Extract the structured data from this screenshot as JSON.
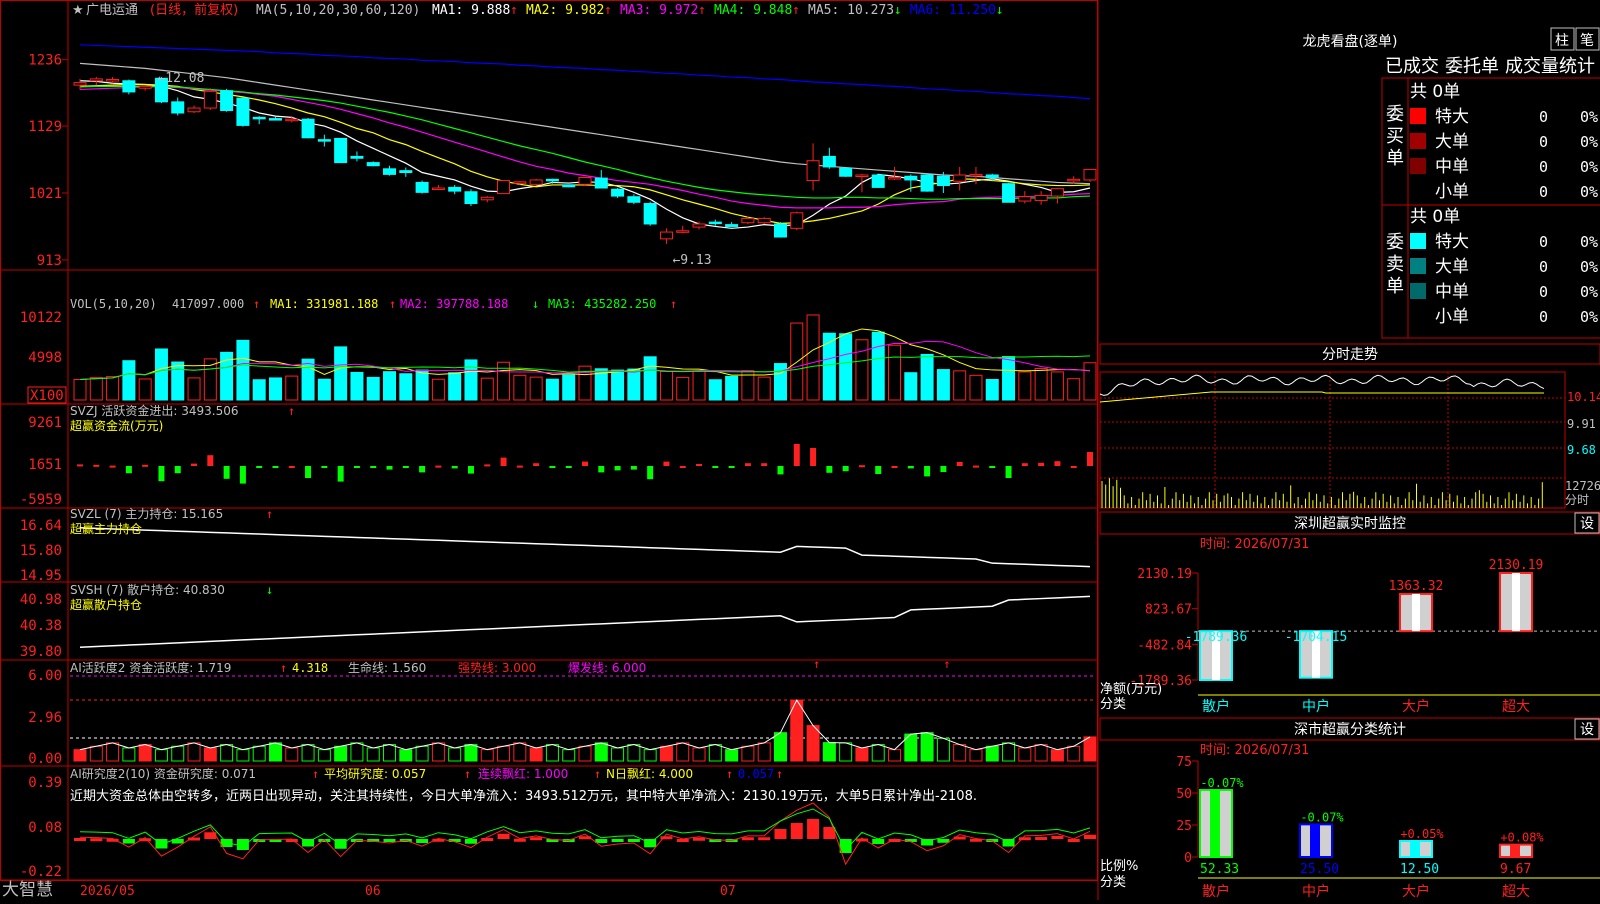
{
  "colors": {
    "up": "#ff2020",
    "down": "#00ffff",
    "frame": "#c00000",
    "ma1": "#ffffff",
    "ma2": "#ffff00",
    "ma3": "#ff00ff",
    "ma4": "#00ff00",
    "ma5": "#c0c0c0",
    "ma6": "#0000ff",
    "text": "#c0c0c0",
    "green": "#00ff00",
    "yellow": "#ffff00"
  },
  "main": {
    "title_star": "★",
    "title_name": "广电运通",
    "title_period": "(日线，前复权)",
    "ma_label": "MA(5,10,20,30,60,120)",
    "ma_items": [
      {
        "label": "MA1:",
        "value": "9.888",
        "arrow": "↑"
      },
      {
        "label": "MA2:",
        "value": "9.982",
        "arrow": "↑"
      },
      {
        "label": "MA3:",
        "value": "9.972",
        "arrow": "↑"
      },
      {
        "label": "MA4:",
        "value": "9.848",
        "arrow": "↑"
      },
      {
        "label": "MA5:",
        "value": "10.273",
        "arrow": "↓"
      },
      {
        "label": "MA6:",
        "value": "11.250",
        "arrow": "↓"
      }
    ],
    "y_ticks": [
      "1236",
      "1129",
      "1021",
      "913"
    ],
    "high_note": "←12.08",
    "low_note": "←9.13"
  },
  "chart_data": {
    "type": "candlestick",
    "dates_axis": [
      "2026/05",
      "06",
      "07"
    ],
    "ohlc": [
      [
        11.95,
        12.05,
        11.88,
        11.99
      ],
      [
        12.02,
        12.08,
        11.95,
        12.05
      ],
      [
        12.03,
        12.08,
        11.98,
        12.04
      ],
      [
        12.02,
        12.04,
        11.8,
        11.84
      ],
      [
        11.9,
        11.95,
        11.86,
        11.93
      ],
      [
        12.06,
        12.08,
        11.66,
        11.68
      ],
      [
        11.68,
        11.75,
        11.46,
        11.5
      ],
      [
        11.52,
        11.62,
        11.5,
        11.58
      ],
      [
        11.58,
        11.9,
        11.55,
        11.85
      ],
      [
        11.86,
        11.89,
        11.52,
        11.54
      ],
      [
        11.74,
        11.76,
        11.28,
        11.3
      ],
      [
        11.43,
        11.45,
        11.32,
        11.41
      ],
      [
        11.41,
        11.44,
        11.38,
        11.4
      ],
      [
        11.4,
        11.45,
        11.35,
        11.4
      ],
      [
        11.4,
        11.42,
        11.09,
        11.1
      ],
      [
        11.07,
        11.15,
        10.96,
        11.06
      ],
      [
        11.09,
        11.09,
        10.7,
        10.7
      ],
      [
        10.8,
        10.88,
        10.72,
        10.77
      ],
      [
        10.7,
        10.72,
        10.64,
        10.65
      ],
      [
        10.6,
        10.65,
        10.49,
        10.51
      ],
      [
        10.57,
        10.62,
        10.47,
        10.54
      ],
      [
        10.38,
        10.41,
        10.2,
        10.22
      ],
      [
        10.28,
        10.34,
        10.26,
        10.29
      ],
      [
        10.3,
        10.34,
        10.19,
        10.24
      ],
      [
        10.23,
        10.27,
        10.0,
        10.04
      ],
      [
        10.1,
        10.16,
        10.06,
        10.14
      ],
      [
        10.2,
        10.41,
        10.2,
        10.41
      ],
      [
        10.38,
        10.4,
        10.34,
        10.39
      ],
      [
        10.35,
        10.44,
        10.34,
        10.42
      ],
      [
        10.43,
        10.44,
        10.36,
        10.42
      ],
      [
        10.34,
        10.34,
        10.3,
        10.31
      ],
      [
        10.35,
        10.47,
        10.32,
        10.46
      ],
      [
        10.45,
        10.58,
        10.29,
        10.29
      ],
      [
        10.27,
        10.29,
        10.13,
        10.16
      ],
      [
        10.15,
        10.19,
        10.03,
        10.06
      ],
      [
        10.04,
        10.07,
        9.68,
        9.71
      ],
      [
        9.47,
        9.64,
        9.39,
        9.58
      ],
      [
        9.6,
        9.68,
        9.56,
        9.6
      ],
      [
        9.66,
        9.75,
        9.62,
        9.71
      ],
      [
        9.74,
        9.78,
        9.68,
        9.72
      ],
      [
        9.7,
        9.74,
        9.66,
        9.67
      ],
      [
        9.73,
        9.83,
        9.71,
        9.8
      ],
      [
        9.73,
        9.82,
        9.71,
        9.8
      ],
      [
        9.71,
        9.74,
        9.49,
        9.5
      ],
      [
        9.64,
        9.91,
        9.61,
        9.89
      ],
      [
        10.41,
        11.01,
        10.25,
        10.73
      ],
      [
        10.8,
        10.94,
        10.6,
        10.63
      ],
      [
        10.61,
        10.62,
        10.47,
        10.48
      ],
      [
        10.48,
        10.52,
        10.22,
        10.5
      ],
      [
        10.5,
        10.52,
        10.29,
        10.3
      ],
      [
        10.46,
        10.63,
        10.42,
        10.46
      ],
      [
        10.48,
        10.51,
        10.23,
        10.42
      ],
      [
        10.5,
        10.51,
        10.23,
        10.24
      ],
      [
        10.48,
        10.55,
        10.21,
        10.33
      ],
      [
        10.4,
        10.63,
        10.25,
        10.5
      ],
      [
        10.5,
        10.63,
        10.35,
        10.51
      ],
      [
        10.5,
        10.52,
        10.4,
        10.46
      ],
      [
        10.36,
        10.37,
        10.06,
        10.06
      ],
      [
        10.08,
        10.24,
        10.04,
        10.15
      ],
      [
        10.09,
        10.24,
        10.02,
        10.17
      ],
      [
        10.16,
        10.29,
        10.04,
        10.28
      ],
      [
        10.43,
        10.48,
        10.36,
        10.43
      ],
      [
        10.42,
        10.59,
        10.39,
        10.59
      ]
    ],
    "ma": {
      "ma5": [
        12.02,
        12.01,
        11.98,
        11.97,
        11.96,
        11.93,
        11.86,
        11.76,
        11.72,
        11.66,
        11.59,
        11.5,
        11.45,
        11.43,
        11.34,
        11.29,
        11.19,
        11.05,
        10.93,
        10.81,
        10.69,
        10.54,
        10.48,
        10.42,
        10.32,
        10.24,
        10.23,
        10.28,
        10.32,
        10.38,
        10.37,
        10.39,
        10.38,
        10.32,
        10.22,
        10.11,
        9.95,
        9.81,
        9.71,
        9.67,
        9.64,
        9.66,
        9.7,
        9.68,
        9.7,
        9.85,
        10.03,
        10.16,
        10.38,
        10.51,
        10.48,
        10.44,
        10.38,
        10.35,
        10.37,
        10.41,
        10.44,
        10.4,
        10.35,
        10.3,
        10.22,
        10.23,
        10.29
      ],
      "ma10": [
        11.93,
        11.94,
        11.95,
        11.96,
        11.96,
        11.95,
        11.93,
        11.88,
        11.84,
        11.8,
        11.76,
        11.71,
        11.65,
        11.58,
        11.5,
        11.44,
        11.35,
        11.25,
        11.18,
        11.07,
        10.99,
        10.88,
        10.78,
        10.68,
        10.56,
        10.47,
        10.4,
        10.35,
        10.31,
        10.34,
        10.34,
        10.34,
        10.33,
        10.33,
        10.31,
        10.26,
        10.18,
        10.1,
        10.03,
        9.96,
        9.88,
        9.82,
        9.77,
        9.72,
        9.73,
        9.76,
        9.8,
        9.86,
        9.92,
        10.03,
        10.18,
        10.29,
        10.34,
        10.38,
        10.44,
        10.43,
        10.41,
        10.39,
        10.36,
        10.34,
        10.33,
        10.33,
        10.34
      ],
      "ma20": [
        11.88,
        11.89,
        11.9,
        11.91,
        11.92,
        11.92,
        11.91,
        11.89,
        11.87,
        11.85,
        11.83,
        11.8,
        11.77,
        11.72,
        11.67,
        11.62,
        11.56,
        11.49,
        11.42,
        11.34,
        11.27,
        11.19,
        11.11,
        11.03,
        10.95,
        10.87,
        10.79,
        10.71,
        10.64,
        10.59,
        10.53,
        10.49,
        10.45,
        10.41,
        10.38,
        10.35,
        10.3,
        10.25,
        10.19,
        10.14,
        10.08,
        10.04,
        10.01,
        9.98,
        9.97,
        9.97,
        9.97,
        9.98,
        9.98,
        9.99,
        10.02,
        10.04,
        10.06,
        10.07,
        10.11,
        10.13,
        10.14,
        10.15,
        10.15,
        10.16,
        10.17,
        10.19,
        10.2
      ],
      "ma30": [
        11.92,
        11.93,
        11.93,
        11.93,
        11.93,
        11.93,
        11.92,
        11.9,
        11.88,
        11.86,
        11.84,
        11.81,
        11.79,
        11.76,
        11.73,
        11.7,
        11.66,
        11.61,
        11.56,
        11.51,
        11.45,
        11.39,
        11.32,
        11.25,
        11.18,
        11.11,
        11.04,
        10.97,
        10.91,
        10.85,
        10.78,
        10.71,
        10.65,
        10.59,
        10.52,
        10.46,
        10.4,
        10.35,
        10.3,
        10.26,
        10.23,
        10.2,
        10.18,
        10.16,
        10.14,
        10.13,
        10.13,
        10.14,
        10.14,
        10.13,
        10.13,
        10.12,
        10.11,
        10.11,
        10.12,
        10.12,
        10.12,
        10.12,
        10.13,
        10.13,
        10.13,
        10.15,
        10.16
      ],
      "ma60": [
        12.3,
        12.28,
        12.26,
        12.24,
        12.22,
        12.19,
        12.16,
        12.13,
        12.1,
        12.07,
        12.03,
        11.99,
        11.95,
        11.91,
        11.87,
        11.83,
        11.79,
        11.75,
        11.71,
        11.67,
        11.63,
        11.59,
        11.55,
        11.51,
        11.47,
        11.43,
        11.39,
        11.35,
        11.31,
        11.27,
        11.23,
        11.19,
        11.15,
        11.11,
        11.07,
        11.03,
        10.99,
        10.95,
        10.91,
        10.87,
        10.83,
        10.79,
        10.75,
        10.71,
        10.68,
        10.66,
        10.64,
        10.62,
        10.6,
        10.58,
        10.56,
        10.54,
        10.52,
        10.5,
        10.49,
        10.48,
        10.46,
        10.44,
        10.42,
        10.4,
        10.38,
        10.37,
        10.36
      ],
      "ma120": [
        12.6,
        12.59,
        12.58,
        12.57,
        12.56,
        12.55,
        12.54,
        12.53,
        12.52,
        12.51,
        12.5,
        12.49,
        12.47,
        12.46,
        12.45,
        12.43,
        12.42,
        12.41,
        12.39,
        12.38,
        12.37,
        12.35,
        12.34,
        12.33,
        12.31,
        12.3,
        12.29,
        12.27,
        12.26,
        12.24,
        12.23,
        12.22,
        12.2,
        12.19,
        12.17,
        12.16,
        12.14,
        12.13,
        12.11,
        12.1,
        12.08,
        12.07,
        12.05,
        12.04,
        12.02,
        12.0,
        11.99,
        11.97,
        11.96,
        11.94,
        11.93,
        11.91,
        11.89,
        11.88,
        11.86,
        11.85,
        11.83,
        11.81,
        11.8,
        11.78,
        11.77,
        11.75,
        11.73
      ]
    },
    "volume_axis": [
      "10122",
      "4998",
      "X100"
    ],
    "svzj_axis": [
      "9261",
      "1651",
      "-5959"
    ],
    "svzl_axis": [
      "16.64",
      "15.80",
      "14.95"
    ],
    "svsh_axis": [
      "40.98",
      "40.38",
      "39.80"
    ],
    "ai1_axis": [
      "6.00",
      "2.96",
      "0.00"
    ],
    "ai2_axis": [
      "0.39",
      "0.08",
      "-0.22"
    ]
  },
  "vol_panel": {
    "label": "VOL(5,10,20)",
    "val": "417097.000",
    "v_arrow": "↑",
    "ma1": "MA1: 331981.188",
    "a1": "↑",
    "ma2": "MA2: 397788.188",
    "a2": "↓",
    "ma3": "MA3: 435282.250",
    "a3": "↑"
  },
  "svzj_panel": {
    "label": "SVZJ  活跃资金进出: 3493.506",
    "arrow": "↑",
    "sub": "超赢资金流(万元)"
  },
  "svzl_panel": {
    "label": "SVZL (7) 主力持仓: 15.165",
    "arrow": "↑",
    "sub": "超赢主力持仓"
  },
  "svsh_panel": {
    "label": "SVSH (7) 散户持仓: 40.830",
    "arrow": "↓",
    "sub": "超赢散户持仓"
  },
  "ai1_panel": {
    "label": "AI活跃度2 资金活跃度: 1.719",
    "a1": "↑",
    "v2": "4.318",
    "life": "生命线: 1.560",
    "strong": "强势线: 3.000",
    "burst": "爆发线: 6.000"
  },
  "ai2_panel": {
    "label": "AI研究度2(10) 资金研究度: 0.071",
    "a1": "↑",
    "avg": "平均研究度: 0.057",
    "a2": "↑",
    "cont": "连续飘红: 1.000",
    "a3": "↑",
    "nday": "N日飘红: 4.000",
    "a4": "↑",
    "last": "0.057",
    "a5": "↑",
    "summary": "近期大资金总体由空转多，近两日出现异动，关注其持续性，今日大单净流入：3493.512万元，其中特大单净流入：2130.19万元，大单5日累计净出-2108."
  },
  "bottom": {
    "logo": "大智慧",
    "date1": "2026/05",
    "date2": "06",
    "date3": "07"
  },
  "right": {
    "dragon_title": "龙虎看盘(逐单)",
    "btn_zhu": "柱",
    "btn_bi": "笔",
    "tabs": [
      "已成交",
      "委托单",
      "成交量统计"
    ],
    "buy_title": "委买单",
    "sell_title": "委卖单",
    "buy_total": "共 0单",
    "sell_total": "共 0单",
    "buy_rows": [
      {
        "name": "特大",
        "n": "0",
        "p": "0%",
        "c": "#ff0000"
      },
      {
        "name": "大单",
        "n": "0",
        "p": "0%",
        "c": "#a00000"
      },
      {
        "name": "中单",
        "n": "0",
        "p": "0%",
        "c": "#800000"
      },
      {
        "name": "小单",
        "n": "0",
        "p": "0%",
        "c": ""
      }
    ],
    "sell_rows": [
      {
        "name": "特大",
        "n": "0",
        "p": "0%",
        "c": "#00ffff"
      },
      {
        "name": "大单",
        "n": "0",
        "p": "0%",
        "c": "#008080"
      },
      {
        "name": "中单",
        "n": "0",
        "p": "0%",
        "c": "#006a6a"
      },
      {
        "name": "小单",
        "n": "0",
        "p": "0%",
        "c": ""
      }
    ],
    "intraday_title": "分时走势",
    "intraday_ticks": [
      "10.14",
      "9.91",
      "9.68",
      "12726",
      "分时"
    ],
    "sz_title": "深圳超赢实时监控",
    "sz_btn": "设",
    "sz_time": "时间: 2026/07/31",
    "sz_axis": [
      "2130.19",
      "823.67",
      "-482.84",
      "-1789.36"
    ],
    "sz_bars": [
      {
        "name": "散户",
        "value": -1789.36,
        "label": "-1789.36"
      },
      {
        "name": "中户",
        "value": -1704.15,
        "label": "-1704.15"
      },
      {
        "name": "大户",
        "value": 1363.32,
        "label": "1363.32"
      },
      {
        "name": "超大",
        "value": 2130.19,
        "label": "2130.19"
      }
    ],
    "sz_ylabel1": "净额(万元)",
    "sz_ylabel2": "分类",
    "cls_title": "深市超赢分类统计",
    "cls_btn": "设",
    "cls_time": "时间: 2026/07/31",
    "cls_axis": [
      "75",
      "50",
      "25",
      "0"
    ],
    "cls_bars": [
      {
        "name": "散户",
        "value": 52.33,
        "label": "52.33",
        "chg": "-0.07%"
      },
      {
        "name": "中户",
        "value": 25.5,
        "label": "25.50",
        "chg": "-0.07%"
      },
      {
        "name": "大户",
        "value": 12.5,
        "label": "12.50",
        "chg": "+0.05%"
      },
      {
        "name": "超大",
        "value": 9.67,
        "label": "9.67",
        "chg": "+0.08%"
      }
    ],
    "cls_ylabel1": "比例%",
    "cls_ylabel2": "分类"
  }
}
